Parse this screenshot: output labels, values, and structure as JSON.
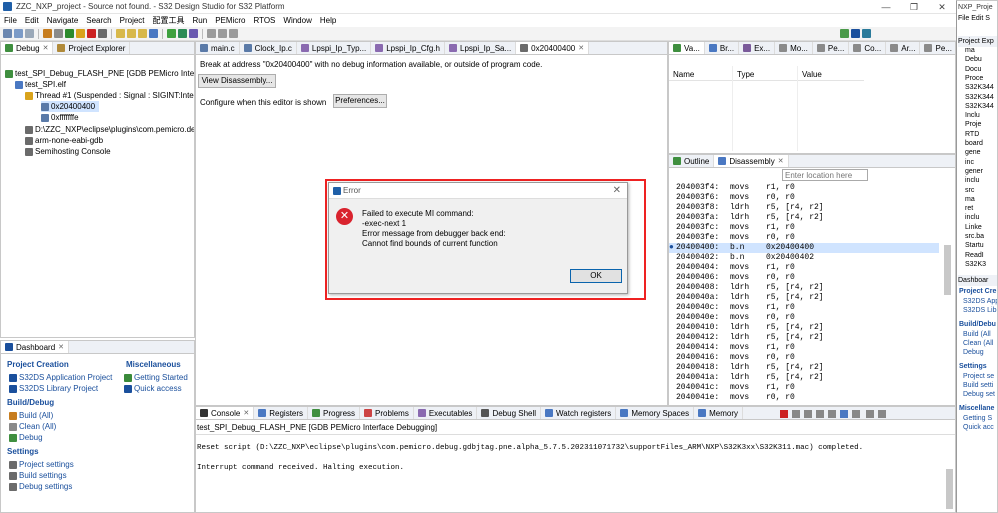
{
  "window": {
    "title": "ZZC_NXP_project - Source not found. - S32 Design Studio for S32 Platform",
    "minimize": "—",
    "restore": "❐",
    "close": "✕"
  },
  "menu": [
    "File",
    "Edit",
    "Navigate",
    "Search",
    "Project",
    "配置工具",
    "Run",
    "PEMicro",
    "RTOS",
    "Window",
    "Help"
  ],
  "debug_view": {
    "tabs": [
      {
        "label": "Debug",
        "close": "✕"
      },
      {
        "label": "Project Explorer",
        "close": "✕"
      }
    ],
    "tree": [
      {
        "label": "test_SPI_Debug_FLASH_PNE [GDB PEMicro Interface Debugging]"
      },
      {
        "label": "test_SPI.elf"
      },
      {
        "label": "Thread #1 (Suspended : Signal : SIGINT:Interrupt)"
      },
      {
        "label": "0x20400400"
      },
      {
        "label": "0xfffffffe"
      },
      {
        "label": "D:\\ZZC_NXP\\eclipse\\plugins\\com.pemicro.debug"
      },
      {
        "label": "arm-none-eabi-gdb"
      },
      {
        "label": "Semihosting Console"
      }
    ]
  },
  "editor": {
    "tabs": [
      "main.c",
      "Clock_Ip.c",
      "Lpspi_Ip_Typ...",
      "Lpspi_Ip_Cfg.h",
      "Lpspi_Ip_Sa...",
      "0x20400400"
    ],
    "message": "Break at address \"0x20400400\" with no debug information available, or outside of program code.",
    "view_disassembly": "View Disassembly...",
    "configure_label": "Configure when this editor is shown",
    "preferences": "Preferences..."
  },
  "variables_view": {
    "tabs": [
      "Va...",
      "Br...",
      "Ex...",
      "Mo...",
      "Pe...",
      "Co...",
      "Ar...",
      "Pe..."
    ],
    "columns": [
      "Name",
      "Type",
      "Value"
    ]
  },
  "disassembly_view": {
    "tabs": [
      "Outline",
      "Disassembly"
    ],
    "location_placeholder": "Enter location here",
    "current_address": "20400400",
    "rows": [
      {
        "addr": "204003f4:",
        "op": "movs",
        "args": "r1, r0"
      },
      {
        "addr": "204003f6:",
        "op": "movs",
        "args": "r0, r0"
      },
      {
        "addr": "204003f8:",
        "op": "ldrh",
        "args": "r5, [r4, r2]"
      },
      {
        "addr": "204003fa:",
        "op": "ldrh",
        "args": "r5, [r4, r2]"
      },
      {
        "addr": "204003fc:",
        "op": "movs",
        "args": "r1, r0"
      },
      {
        "addr": "204003fe:",
        "op": "movs",
        "args": "r0, r0"
      },
      {
        "addr": "20400400:",
        "op": "b.n",
        "args": "0x20400400"
      },
      {
        "addr": "20400402:",
        "op": "b.n",
        "args": "0x20400402"
      },
      {
        "addr": "20400404:",
        "op": "movs",
        "args": "r1, r0"
      },
      {
        "addr": "20400406:",
        "op": "movs",
        "args": "r0, r0"
      },
      {
        "addr": "20400408:",
        "op": "ldrh",
        "args": "r5, [r4, r2]"
      },
      {
        "addr": "2040040a:",
        "op": "ldrh",
        "args": "r5, [r4, r2]"
      },
      {
        "addr": "2040040c:",
        "op": "movs",
        "args": "r1, r0"
      },
      {
        "addr": "2040040e:",
        "op": "movs",
        "args": "r0, r0"
      },
      {
        "addr": "20400410:",
        "op": "ldrh",
        "args": "r5, [r4, r2]"
      },
      {
        "addr": "20400412:",
        "op": "ldrh",
        "args": "r5, [r4, r2]"
      },
      {
        "addr": "20400414:",
        "op": "movs",
        "args": "r1, r0"
      },
      {
        "addr": "20400416:",
        "op": "movs",
        "args": "r0, r0"
      },
      {
        "addr": "20400418:",
        "op": "ldrh",
        "args": "r5, [r4, r2]"
      },
      {
        "addr": "2040041a:",
        "op": "ldrh",
        "args": "r5, [r4, r2]"
      },
      {
        "addr": "2040041c:",
        "op": "movs",
        "args": "r1, r0"
      },
      {
        "addr": "2040041e:",
        "op": "movs",
        "args": "r0, r0"
      }
    ]
  },
  "dashboard": {
    "tab": "Dashboard",
    "project_creation": {
      "title": "Project Creation",
      "items": [
        "S32DS Application Project",
        "S32DS Library Project"
      ]
    },
    "misc": {
      "title": "Miscellaneous",
      "items": [
        "Getting Started",
        "Quick access"
      ]
    },
    "build_debug": {
      "title": "Build/Debug",
      "items": [
        "Build  (All)",
        "Clean  (All)",
        "Debug"
      ]
    },
    "settings": {
      "title": "Settings",
      "items": [
        "Project settings",
        "Build settings",
        "Debug settings"
      ]
    }
  },
  "console": {
    "tabs": [
      "Console",
      "Registers",
      "Progress",
      "Problems",
      "Executables",
      "Debug Shell",
      "Watch registers",
      "Memory Spaces",
      "Memory"
    ],
    "session": "test_SPI_Debug_FLASH_PNE [GDB PEMicro Interface Debugging]",
    "lines": [
      "Reset script (D:\\ZZC_NXP\\eclipse\\plugins\\com.pemicro.debug.gdbjtag.pne.alpha_5.7.5.202311071732\\supportFiles_ARM\\NXP\\S32K3xx\\S32K311.mac) completed.",
      "Interrupt command received. Halting execution."
    ]
  },
  "right_window": {
    "title": "NXP_Proje",
    "menu": [
      "File",
      "Edit",
      "S"
    ],
    "explorer_tab": "Project Exp",
    "tree": [
      "ma",
      "Debu",
      "Docu",
      "Proce",
      "S32K344",
      "S32K344",
      "S32K344",
      "Inclu",
      "Proje",
      "RTD",
      "board",
      "gene",
      "inc",
      "gener",
      "inclu",
      "src",
      "ma",
      "ret",
      "inclu",
      "Linke",
      "src.ba",
      "Startu",
      "ReadI",
      "S32K3"
    ],
    "dash_tab": "Dashboar",
    "sections": [
      {
        "title": "Project Cre",
        "items": [
          "S32DS App",
          "S32DS Libr"
        ]
      },
      {
        "title": "Build/Debu",
        "items": [
          "Build  (All",
          "Clean  (All",
          "Debug"
        ]
      },
      {
        "title": "Settings",
        "items": [
          "Project se",
          "Build setti",
          "Debug set"
        ]
      },
      {
        "title": "Miscellane",
        "items": [
          "Getting S",
          "Quick acc"
        ]
      }
    ]
  },
  "error_dialog": {
    "title": "Error",
    "close": "✕",
    "icon_glyph": "✕",
    "lines": [
      "Failed to execute MI command:",
      "-exec-next 1",
      "Error message from debugger back end:",
      "Cannot find bounds of current function"
    ],
    "ok": "OK"
  },
  "colors": {
    "accent": "#1a4f9c",
    "error": "#d9232e",
    "highlight_frame": "#e22222"
  }
}
